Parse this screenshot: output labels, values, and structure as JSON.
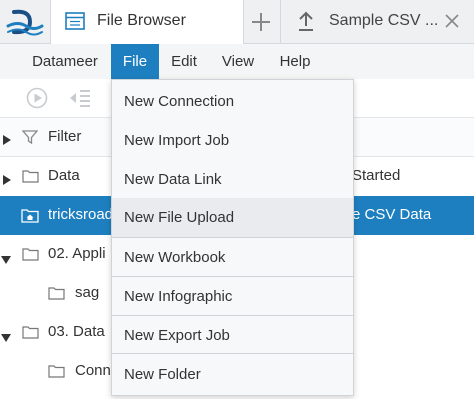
{
  "tabs": [
    {
      "label": "File Browser",
      "icon": "file-browser-icon",
      "active": true
    },
    {
      "label": "Sample CSV ...",
      "icon": "upload-icon",
      "active": false
    }
  ],
  "menubar": {
    "items": [
      "Datameer",
      "File",
      "Edit",
      "View",
      "Help"
    ],
    "active": "File"
  },
  "file_menu": {
    "items": [
      "New Connection",
      "New Import Job",
      "New Data Link",
      "New File Upload",
      "New Workbook",
      "New Infographic",
      "New Export Job",
      "New Folder"
    ],
    "hovered": "New File Upload"
  },
  "tree": {
    "filter_label": "Filter",
    "rows": [
      {
        "label": "Data"
      },
      {
        "label": "tricksroad"
      },
      {
        "label": "02. Appli"
      },
      {
        "label": "sag"
      },
      {
        "label": "03. Data"
      },
      {
        "label": "Conn"
      }
    ],
    "right_column": [
      "Started",
      "e CSV Data"
    ]
  },
  "colors": {
    "accent": "#1e7fc0",
    "tabbar_bg": "#eef0f2",
    "menubar_bg": "#f4f5f6"
  }
}
